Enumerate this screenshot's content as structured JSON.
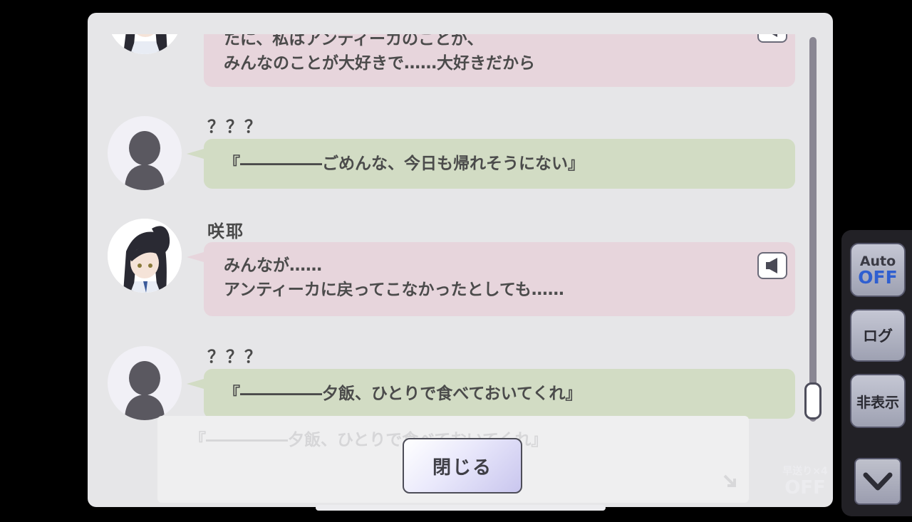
{
  "messages": [
    {
      "speaker": "",
      "style": "pink",
      "has_voice": true,
      "lines": [
        "たに、私はアンティーカのことが、",
        "みんなのことが大好きで……大好きだから"
      ]
    },
    {
      "speaker": "？？？",
      "style": "green",
      "has_voice": false,
      "lines": [
        "『―――――ごめんな、今日も帰れそうにない』"
      ]
    },
    {
      "speaker": "咲耶",
      "style": "pink",
      "has_voice": true,
      "lines": [
        "みんなが……",
        "アンティーカに戻ってこなかったとしても……"
      ]
    },
    {
      "speaker": "？？？",
      "style": "green",
      "has_voice": false,
      "lines": [
        "『―――――夕飯、ひとりで食べておいてくれ』"
      ]
    }
  ],
  "background_text": "『―――――夕飯、ひとりで食べておいてくれ』",
  "close_button": "閉じる",
  "side": {
    "auto_label": "Auto",
    "auto_state": "OFF",
    "log_label": "ログ",
    "hide_label": "非表示",
    "fast_forward_label": "早送り×4",
    "fast_forward_state": "OFF"
  },
  "colors": {
    "pink_bubble": "#e7d5dc",
    "green_bubble": "#d2dcc4",
    "auto_off": "#2f5fd0"
  },
  "icons": [
    "speaker-icon",
    "silhouette-icon",
    "chevron-down-icon"
  ]
}
